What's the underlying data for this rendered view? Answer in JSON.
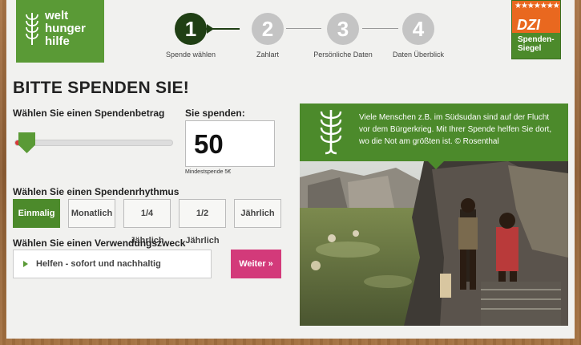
{
  "brand": {
    "line1": "welt",
    "line2": "hunger",
    "line3": "hilfe"
  },
  "steps": [
    {
      "num": "1",
      "label": "Spende wählen",
      "active": true
    },
    {
      "num": "2",
      "label": "Zahlart",
      "active": false
    },
    {
      "num": "3",
      "label": "Persönliche Daten",
      "active": false
    },
    {
      "num": "4",
      "label": "Daten Überblick",
      "active": false
    }
  ],
  "dzi": {
    "title": "DZI",
    "line1": "Spenden-",
    "line2": "Siegel"
  },
  "heading": "BITTE SPENDEN SIE!",
  "amount": {
    "slider_label": "Wählen Sie einen Spendenbetrag",
    "box_label": "Sie spenden:",
    "value": "50",
    "min_note": "Mindestspende 5€"
  },
  "rhythm": {
    "label": "Wählen Sie einen Spendenrhythmus",
    "options": [
      "Einmalig",
      "Monatlich",
      "1/4 Jährlich",
      "1/2 Jährlich",
      "Jährlich"
    ],
    "selected": "Einmalig"
  },
  "purpose": {
    "label": "Wählen Sie einen Verwendungszweck",
    "value": "Helfen - sofort und nachhaltig",
    "submit": "Weiter »"
  },
  "caption": "Viele Menschen z.B. im Südsudan sind auf der Flucht vor dem Bürgerkrieg. Mit Ihrer Spende helfen Sie dort, wo die Not am größten ist. © Rosenthal",
  "colors": {
    "green": "#4c8a2b",
    "dark_green": "#1f3f14",
    "pink": "#d33a7a",
    "orange": "#e9681f"
  }
}
